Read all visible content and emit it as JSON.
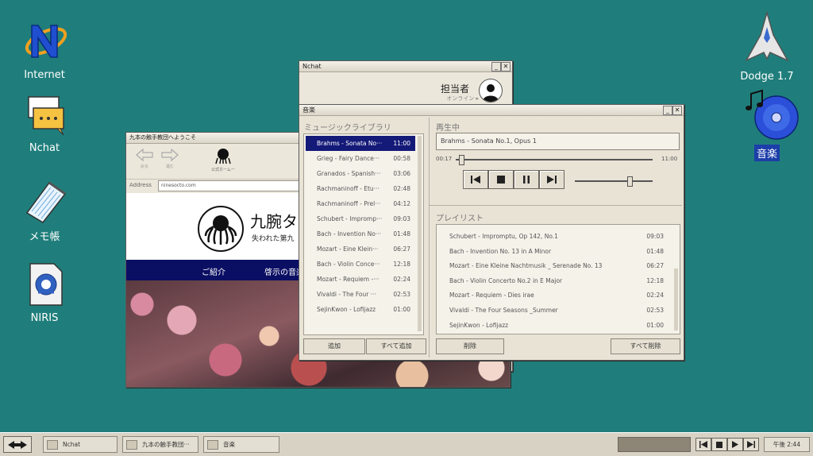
{
  "desktop": {
    "icons_left": [
      {
        "label": "Internet",
        "icon": "internet-icon"
      },
      {
        "label": "Nchat",
        "icon": "chat-icon"
      },
      {
        "label": "メモ帳",
        "icon": "notepad-icon"
      },
      {
        "label": "NIRIS",
        "icon": "niris-icon"
      }
    ],
    "icons_right": [
      {
        "label": "Dodge 1.7",
        "icon": "rocket-icon"
      },
      {
        "label": "音楽",
        "icon": "music-cd-icon"
      }
    ]
  },
  "browser": {
    "title": "九本の触手教団へようこそ",
    "back_label": "戻る",
    "forward_label": "進む",
    "home_label": "公式ホームー",
    "address_label": "Address",
    "address_value": "ninesocto.com",
    "site_title": "九腕タ",
    "site_subtitle": "失われた第九",
    "nav": [
      "ご紹介",
      "啓示の音楽"
    ]
  },
  "nchat": {
    "title": "Nchat",
    "user_name": "担当者",
    "status": "オンライン ▸"
  },
  "music": {
    "title": "音楽",
    "library_header": "ミュージックライブラリ",
    "library": [
      {
        "title": "Brahms - Sonata No···",
        "time": "11:00",
        "selected": true
      },
      {
        "title": "Grieg - Fairy Dance···",
        "time": "00:58",
        "selected": false
      },
      {
        "title": "Granados - Spanish···",
        "time": "03:06",
        "selected": false
      },
      {
        "title": "Rachmaninoff - Etu···",
        "time": "02:48",
        "selected": false
      },
      {
        "title": "Rachmaninoff - Prel···",
        "time": "04:12",
        "selected": false
      },
      {
        "title": "Schubert - Impromp···",
        "time": "09:03",
        "selected": false
      },
      {
        "title": "Bach - Invention No···",
        "time": "01:48",
        "selected": false
      },
      {
        "title": "Mozart - Eine Klein···",
        "time": "06:27",
        "selected": false
      },
      {
        "title": "Bach - Violin Conce···",
        "time": "12:18",
        "selected": false
      },
      {
        "title": "Mozart - Requiem -···",
        "time": "02:24",
        "selected": false
      },
      {
        "title": "Vivaldi - The Four ···",
        "time": "02:53",
        "selected": false
      },
      {
        "title": "SejinKwon - Lofijazz",
        "time": "01:00",
        "selected": false
      }
    ],
    "add_label": "追加",
    "add_all_label": "すべて追加",
    "now_playing_header": "再生中",
    "now_playing": "Brahms - Sonata No.1, Opus 1",
    "elapsed": "00:17",
    "duration": "11:00",
    "progress_fraction": 0.03,
    "volume_fraction": 0.7,
    "playlist_header": "プレイリスト",
    "playlist": [
      {
        "title": "Schubert - Impromptu, Op 142, No.1",
        "time": "09:03"
      },
      {
        "title": "Bach - Invention No. 13 in A Minor",
        "time": "01:48"
      },
      {
        "title": "Mozart - Eine Kleine Nachtmusik _ Serenade No. 13",
        "time": "06:27"
      },
      {
        "title": "Bach - Violin Concerto No.2 in E Major",
        "time": "12:18"
      },
      {
        "title": "Mozart - Requiem - Dies irae",
        "time": "02:24"
      },
      {
        "title": "Vivaldi - The Four Seasons _Summer",
        "time": "02:53"
      },
      {
        "title": "SejinKwon - Lofijazz",
        "time": "01:00"
      }
    ],
    "delete_label": "削除",
    "delete_all_label": "すべて削除"
  },
  "taskbar": {
    "tasks": [
      {
        "label": "Nchat"
      },
      {
        "label": "九本の触手教団···"
      },
      {
        "label": "音楽"
      }
    ],
    "clock": "午後 2:44"
  },
  "colors": {
    "desktop": "#1f7e7b",
    "selection": "#141a78",
    "site_nav": "#0b0f63"
  }
}
